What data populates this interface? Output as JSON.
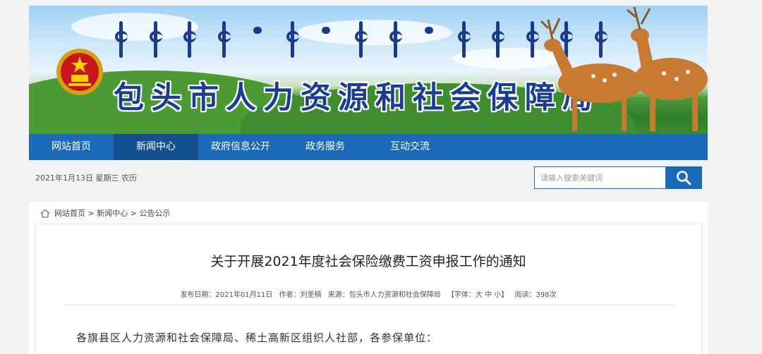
{
  "header": {
    "bureau_name": "包头市人力资源和社会保障局",
    "emblem_icon": "national-emblem-icon"
  },
  "nav": {
    "items": [
      {
        "label": "网站首页"
      },
      {
        "label": "新闻中心"
      },
      {
        "label": "政府信息公开"
      },
      {
        "label": "政务服务"
      },
      {
        "label": "互动交流"
      }
    ],
    "active_index": 1
  },
  "date_line": "2021年1月13日 星期三 农历",
  "search": {
    "placeholder": "请输入搜索关键词",
    "button_icon": "search-icon"
  },
  "breadcrumb": {
    "home_icon": "home-icon",
    "text": "网站首页 > 新闻中心 > 公告公示"
  },
  "article": {
    "title": "关于开展2021年度社会保险缴费工资申报工作的通知",
    "meta": {
      "publish_date": "发布日期：2021年01月11日",
      "author": "作者：刘圣楠",
      "source": "来源：包头市人力资源和社会保障局",
      "font_size": "【字体：大 中 小】",
      "views": "阅读：398次"
    },
    "salutation": "各旗县区人力资源和社会保障局、稀土高新区组织人社部，各参保单位："
  },
  "colors": {
    "nav_blue": "#1a6ab8",
    "nav_active": "#12508f",
    "title_blue": "#1b3d8f"
  }
}
